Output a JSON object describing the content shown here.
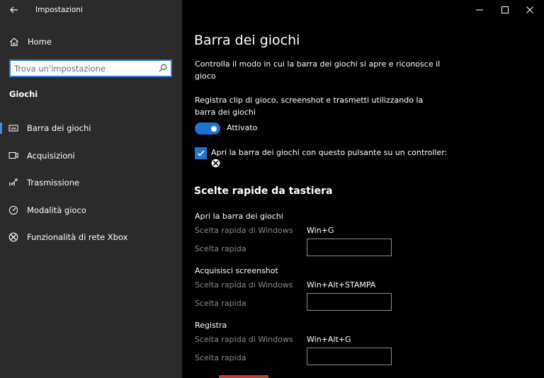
{
  "window": {
    "title": "Impostazioni"
  },
  "sidebar": {
    "home_label": "Home",
    "search": {
      "placeholder": "Trova un'impostazione",
      "value": ""
    },
    "section_title": "Giochi",
    "items": [
      {
        "label": "Barra dei giochi",
        "icon": "game-bar-icon",
        "selected": true
      },
      {
        "label": "Acquisizioni",
        "icon": "capture-icon",
        "selected": false
      },
      {
        "label": "Trasmissione",
        "icon": "broadcast-icon",
        "selected": false
      },
      {
        "label": "Modalità gioco",
        "icon": "game-mode-icon",
        "selected": false
      },
      {
        "label": "Funzionalità di rete Xbox",
        "icon": "xbox-icon",
        "selected": false
      }
    ],
    "accent_color": "#3a8ee6"
  },
  "main": {
    "title": "Barra dei giochi",
    "description": "Controlla il modo in cui la barra dei giochi si apre e riconosce il gioco",
    "record_label": "Registra clip di gioco, screenshot e trasmetti utilizzando la barra dei giochi",
    "toggle": {
      "state": "on",
      "label": "Attivato"
    },
    "checkbox": {
      "checked": true,
      "label": "Apri la barra dei giochi con questo pulsante su un controller:",
      "glyph": "xbox-button-icon"
    },
    "shortcuts_title": "Scelte rapide da tastiera",
    "shortcuts": [
      {
        "title": "Apri la barra dei giochi",
        "windows_label": "Scelta rapida di Windows",
        "windows_value": "Win+G",
        "custom_label": "Scelta rapida",
        "custom_value": ""
      },
      {
        "title": "Acquisisci screenshot",
        "windows_label": "Scelta rapida di Windows",
        "windows_value": "Win+Alt+STAMPA",
        "custom_label": "Scelta rapida",
        "custom_value": ""
      },
      {
        "title": "Registra",
        "windows_label": "Scelta rapida di Windows",
        "windows_value": "Win+Alt+G",
        "custom_label": "Scelta rapida",
        "custom_value": ""
      }
    ],
    "accent_color": "#1f73d1"
  }
}
